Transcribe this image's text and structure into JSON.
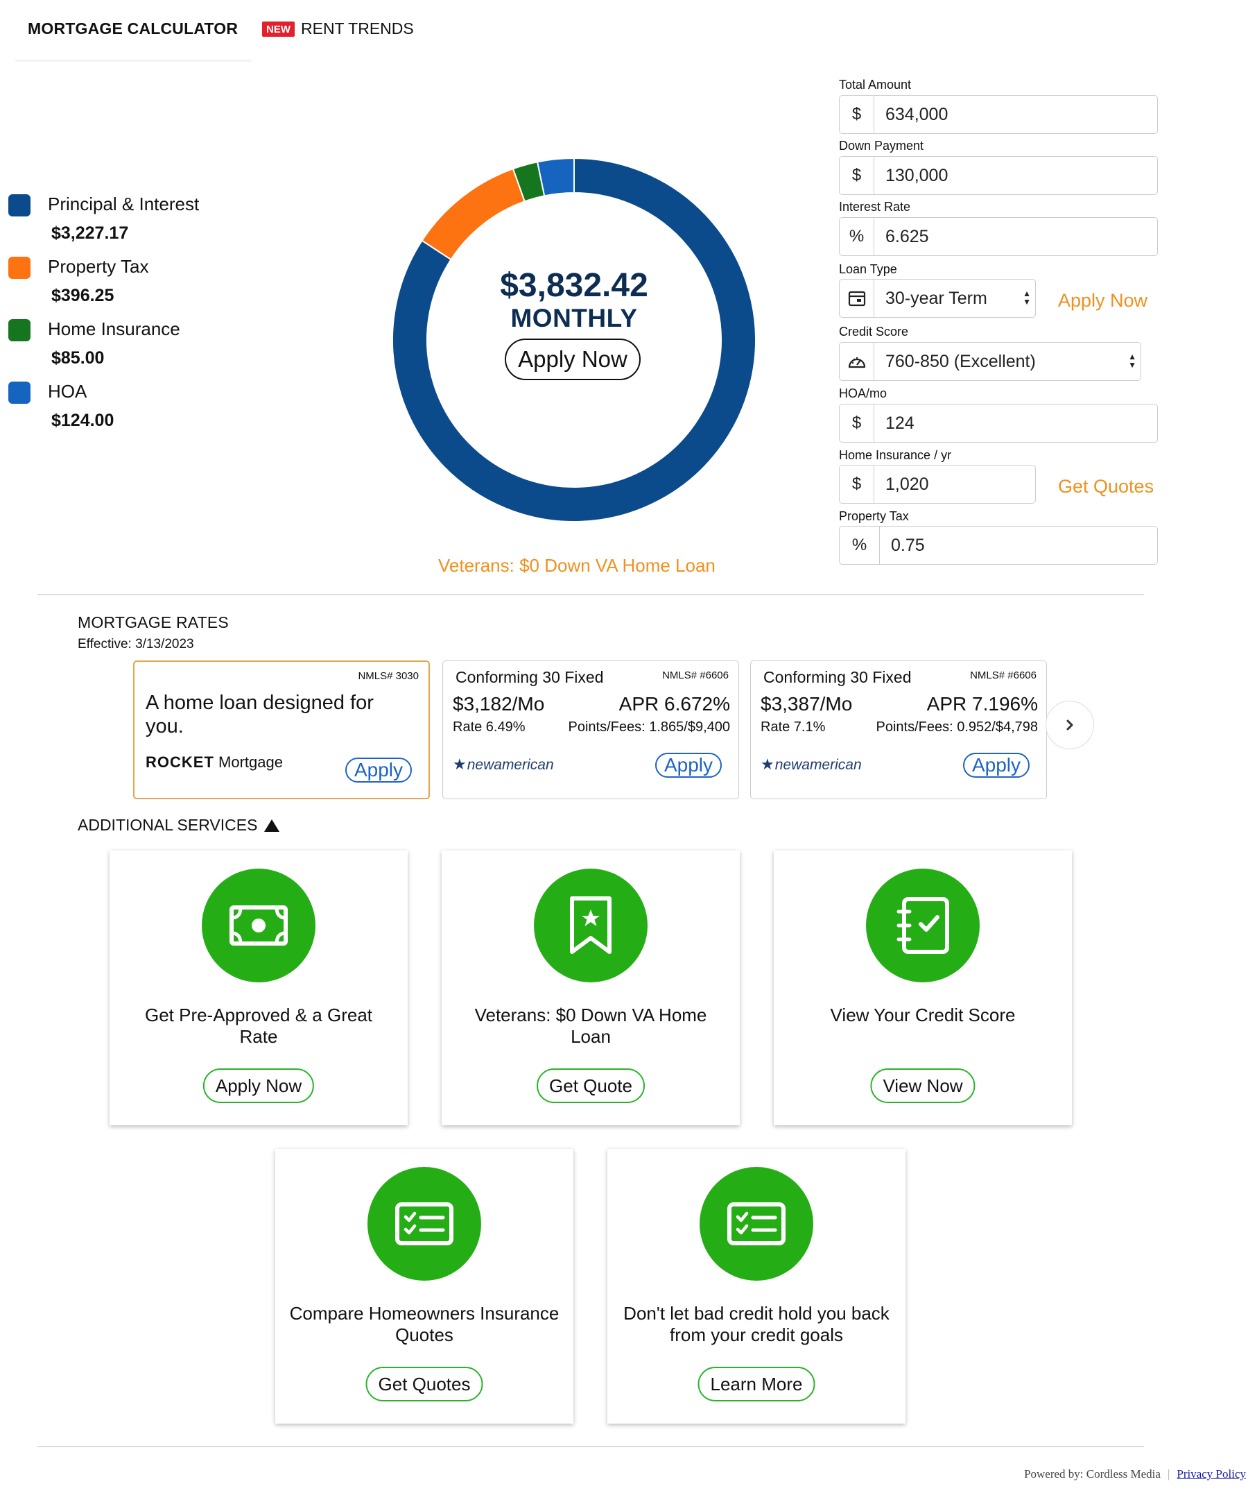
{
  "tabs": {
    "mortgage_calculator": "MORTGAGE CALCULATOR",
    "new_badge": "NEW",
    "rent_trends": "RENT TRENDS"
  },
  "legend": [
    {
      "label": "Principal & Interest",
      "value": "$3,227.17",
      "color": "#0b4a8b"
    },
    {
      "label": "Property Tax",
      "value": "$396.25",
      "color": "#fd7211"
    },
    {
      "label": "Home Insurance",
      "value": "$85.00",
      "color": "#15761f"
    },
    {
      "label": "HOA",
      "value": "$124.00",
      "color": "#1565c0"
    }
  ],
  "donut": {
    "amount": "$3,832.42",
    "period": "MONTHLY",
    "apply_label": "Apply Now",
    "segments": [
      {
        "name": "Principal & Interest",
        "value": 3227.17,
        "color": "#0b4a8b"
      },
      {
        "name": "Property Tax",
        "value": 396.25,
        "color": "#fd7211"
      },
      {
        "name": "Home Insurance",
        "value": 85.0,
        "color": "#15761f"
      },
      {
        "name": "HOA",
        "value": 124.0,
        "color": "#1565c0"
      }
    ]
  },
  "va_link": "Veterans: $0 Down VA Home Loan",
  "form": {
    "total_amount": {
      "label": "Total Amount",
      "prefix": "$",
      "value": "634,000"
    },
    "down_payment": {
      "label": "Down Payment",
      "prefix": "$",
      "value": "130,000"
    },
    "interest_rate": {
      "label": "Interest Rate",
      "prefix": "%",
      "value": "6.625"
    },
    "loan_type": {
      "label": "Loan Type",
      "value": "30-year Term",
      "link": "Apply Now"
    },
    "credit_score": {
      "label": "Credit Score",
      "value": "760-850 (Excellent)"
    },
    "hoa": {
      "label": "HOA/mo",
      "prefix": "$",
      "value": "124"
    },
    "home_insurance": {
      "label": "Home Insurance / yr",
      "prefix": "$",
      "value": "1,020",
      "link": "Get Quotes"
    },
    "property_tax": {
      "label": "Property Tax",
      "prefix": "%",
      "value": "0.75"
    }
  },
  "rates": {
    "title": "MORTGAGE RATES",
    "effective": "Effective: 3/13/2023",
    "cards": [
      {
        "nmls": "NMLS# 3030",
        "promo": "A home loan designed for you.",
        "logo_bold": "ROCKET",
        "logo_rest": "Mortgage",
        "apply": "Apply"
      },
      {
        "nmls": "NMLS# #6606",
        "title": "Conforming 30 Fixed",
        "price": "$3,182/Mo",
        "apr": "APR 6.672%",
        "rate": "Rate 6.49%",
        "points": "Points/Fees: 1.865/$9,400",
        "logo": "newamerican",
        "apply": "Apply"
      },
      {
        "nmls": "NMLS# #6606",
        "title": "Conforming 30 Fixed",
        "price": "$3,387/Mo",
        "apr": "APR 7.196%",
        "rate": "Rate 7.1%",
        "points": "Points/Fees: 0.952/$4,798",
        "logo": "newamerican",
        "apply": "Apply"
      }
    ]
  },
  "services": {
    "title": "ADDITIONAL SERVICES",
    "cards": [
      {
        "text": "Get Pre-Approved & a Great Rate",
        "button": "Apply Now",
        "icon": "money-icon"
      },
      {
        "text": "Veterans: $0 Down VA Home Loan",
        "button": "Get Quote",
        "icon": "bookmark-star-icon"
      },
      {
        "text": "View Your Credit Score",
        "button": "View Now",
        "icon": "checklist-notebook-icon"
      },
      {
        "text": "Compare Homeowners Insurance Quotes",
        "button": "Get Quotes",
        "icon": "checklist-card-icon"
      },
      {
        "text": "Don't let bad credit hold you back from your credit goals",
        "button": "Learn More",
        "icon": "checklist-card-icon"
      }
    ]
  },
  "footer": {
    "powered_by": "Powered by: Cordless Media",
    "separator": "|",
    "privacy": "Privacy Policy"
  }
}
